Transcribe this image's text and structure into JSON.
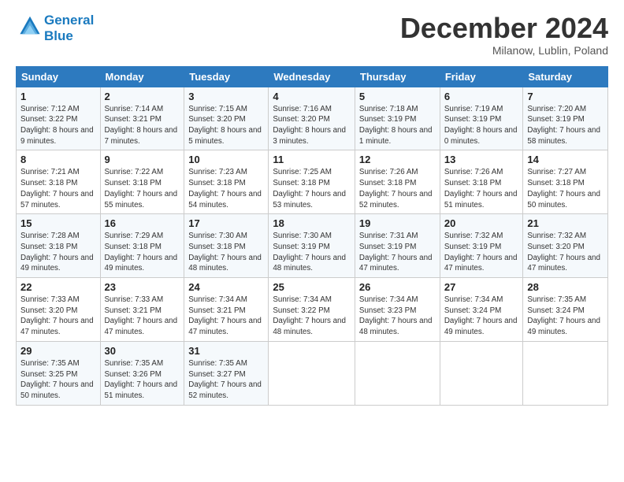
{
  "logo": {
    "line1": "General",
    "line2": "Blue"
  },
  "title": "December 2024",
  "subtitle": "Milanow, Lublin, Poland",
  "weekdays": [
    "Sunday",
    "Monday",
    "Tuesday",
    "Wednesday",
    "Thursday",
    "Friday",
    "Saturday"
  ],
  "weeks": [
    [
      {
        "day": "1",
        "sunrise": "Sunrise: 7:12 AM",
        "sunset": "Sunset: 3:22 PM",
        "daylight": "Daylight: 8 hours and 9 minutes."
      },
      {
        "day": "2",
        "sunrise": "Sunrise: 7:14 AM",
        "sunset": "Sunset: 3:21 PM",
        "daylight": "Daylight: 8 hours and 7 minutes."
      },
      {
        "day": "3",
        "sunrise": "Sunrise: 7:15 AM",
        "sunset": "Sunset: 3:20 PM",
        "daylight": "Daylight: 8 hours and 5 minutes."
      },
      {
        "day": "4",
        "sunrise": "Sunrise: 7:16 AM",
        "sunset": "Sunset: 3:20 PM",
        "daylight": "Daylight: 8 hours and 3 minutes."
      },
      {
        "day": "5",
        "sunrise": "Sunrise: 7:18 AM",
        "sunset": "Sunset: 3:19 PM",
        "daylight": "Daylight: 8 hours and 1 minute."
      },
      {
        "day": "6",
        "sunrise": "Sunrise: 7:19 AM",
        "sunset": "Sunset: 3:19 PM",
        "daylight": "Daylight: 8 hours and 0 minutes."
      },
      {
        "day": "7",
        "sunrise": "Sunrise: 7:20 AM",
        "sunset": "Sunset: 3:19 PM",
        "daylight": "Daylight: 7 hours and 58 minutes."
      }
    ],
    [
      {
        "day": "8",
        "sunrise": "Sunrise: 7:21 AM",
        "sunset": "Sunset: 3:18 PM",
        "daylight": "Daylight: 7 hours and 57 minutes."
      },
      {
        "day": "9",
        "sunrise": "Sunrise: 7:22 AM",
        "sunset": "Sunset: 3:18 PM",
        "daylight": "Daylight: 7 hours and 55 minutes."
      },
      {
        "day": "10",
        "sunrise": "Sunrise: 7:23 AM",
        "sunset": "Sunset: 3:18 PM",
        "daylight": "Daylight: 7 hours and 54 minutes."
      },
      {
        "day": "11",
        "sunrise": "Sunrise: 7:25 AM",
        "sunset": "Sunset: 3:18 PM",
        "daylight": "Daylight: 7 hours and 53 minutes."
      },
      {
        "day": "12",
        "sunrise": "Sunrise: 7:26 AM",
        "sunset": "Sunset: 3:18 PM",
        "daylight": "Daylight: 7 hours and 52 minutes."
      },
      {
        "day": "13",
        "sunrise": "Sunrise: 7:26 AM",
        "sunset": "Sunset: 3:18 PM",
        "daylight": "Daylight: 7 hours and 51 minutes."
      },
      {
        "day": "14",
        "sunrise": "Sunrise: 7:27 AM",
        "sunset": "Sunset: 3:18 PM",
        "daylight": "Daylight: 7 hours and 50 minutes."
      }
    ],
    [
      {
        "day": "15",
        "sunrise": "Sunrise: 7:28 AM",
        "sunset": "Sunset: 3:18 PM",
        "daylight": "Daylight: 7 hours and 49 minutes."
      },
      {
        "day": "16",
        "sunrise": "Sunrise: 7:29 AM",
        "sunset": "Sunset: 3:18 PM",
        "daylight": "Daylight: 7 hours and 49 minutes."
      },
      {
        "day": "17",
        "sunrise": "Sunrise: 7:30 AM",
        "sunset": "Sunset: 3:18 PM",
        "daylight": "Daylight: 7 hours and 48 minutes."
      },
      {
        "day": "18",
        "sunrise": "Sunrise: 7:30 AM",
        "sunset": "Sunset: 3:19 PM",
        "daylight": "Daylight: 7 hours and 48 minutes."
      },
      {
        "day": "19",
        "sunrise": "Sunrise: 7:31 AM",
        "sunset": "Sunset: 3:19 PM",
        "daylight": "Daylight: 7 hours and 47 minutes."
      },
      {
        "day": "20",
        "sunrise": "Sunrise: 7:32 AM",
        "sunset": "Sunset: 3:19 PM",
        "daylight": "Daylight: 7 hours and 47 minutes."
      },
      {
        "day": "21",
        "sunrise": "Sunrise: 7:32 AM",
        "sunset": "Sunset: 3:20 PM",
        "daylight": "Daylight: 7 hours and 47 minutes."
      }
    ],
    [
      {
        "day": "22",
        "sunrise": "Sunrise: 7:33 AM",
        "sunset": "Sunset: 3:20 PM",
        "daylight": "Daylight: 7 hours and 47 minutes."
      },
      {
        "day": "23",
        "sunrise": "Sunrise: 7:33 AM",
        "sunset": "Sunset: 3:21 PM",
        "daylight": "Daylight: 7 hours and 47 minutes."
      },
      {
        "day": "24",
        "sunrise": "Sunrise: 7:34 AM",
        "sunset": "Sunset: 3:21 PM",
        "daylight": "Daylight: 7 hours and 47 minutes."
      },
      {
        "day": "25",
        "sunrise": "Sunrise: 7:34 AM",
        "sunset": "Sunset: 3:22 PM",
        "daylight": "Daylight: 7 hours and 48 minutes."
      },
      {
        "day": "26",
        "sunrise": "Sunrise: 7:34 AM",
        "sunset": "Sunset: 3:23 PM",
        "daylight": "Daylight: 7 hours and 48 minutes."
      },
      {
        "day": "27",
        "sunrise": "Sunrise: 7:34 AM",
        "sunset": "Sunset: 3:24 PM",
        "daylight": "Daylight: 7 hours and 49 minutes."
      },
      {
        "day": "28",
        "sunrise": "Sunrise: 7:35 AM",
        "sunset": "Sunset: 3:24 PM",
        "daylight": "Daylight: 7 hours and 49 minutes."
      }
    ],
    [
      {
        "day": "29",
        "sunrise": "Sunrise: 7:35 AM",
        "sunset": "Sunset: 3:25 PM",
        "daylight": "Daylight: 7 hours and 50 minutes."
      },
      {
        "day": "30",
        "sunrise": "Sunrise: 7:35 AM",
        "sunset": "Sunset: 3:26 PM",
        "daylight": "Daylight: 7 hours and 51 minutes."
      },
      {
        "day": "31",
        "sunrise": "Sunrise: 7:35 AM",
        "sunset": "Sunset: 3:27 PM",
        "daylight": "Daylight: 7 hours and 52 minutes."
      },
      null,
      null,
      null,
      null
    ]
  ]
}
